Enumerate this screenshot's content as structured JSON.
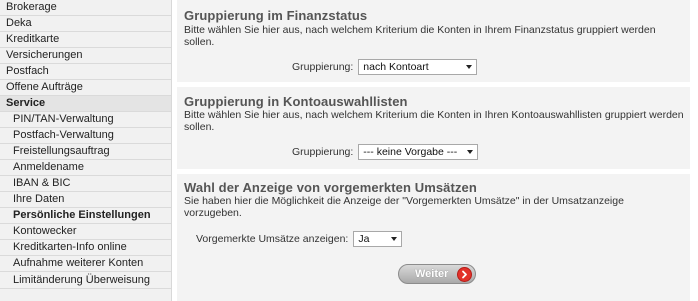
{
  "sidebar": {
    "top_items": [
      "Brokerage",
      "Deka",
      "Kreditkarte",
      "Versicherungen",
      "Postfach",
      "Offene Aufträge"
    ],
    "section": "Service",
    "sub_items": [
      "PIN/TAN-Verwaltung",
      "Postfach-Verwaltung",
      "Freistellungsauftrag",
      "Anmeldename",
      "IBAN & BIC",
      "Ihre Daten",
      "Persönliche Einstellungen",
      "Kontowecker",
      "Kreditkarten-Info online",
      "Aufnahme weiterer Konten",
      "Limitänderung Überweisung"
    ],
    "active_item": "Persönliche Einstellungen"
  },
  "sections": [
    {
      "title": "Gruppierung im Finanzstatus",
      "description": "Bitte wählen Sie hier aus, nach welchem Kriterium die Konten in Ihrem Finanzstatus gruppiert werden sollen.",
      "label": "Gruppierung:",
      "value": "nach Kontoart"
    },
    {
      "title": "Gruppierung in Kontoauswahllisten",
      "description": "Bitte wählen Sie hier aus, nach welchem Kriterium die Konten in Ihren Kontoauswahllisten gruppiert werden sollen.",
      "label": "Gruppierung:",
      "value": "--- keine Vorgabe ---"
    },
    {
      "title": "Wahl der Anzeige von vorgemerkten Umsätzen",
      "description": "Sie haben hier die Möglichkeit die Anzeige der \"Vorgemerkten Umsätze\" in der Umsatzanzeige vorzugeben.",
      "label": "Vorgemerkte Umsätze anzeigen:",
      "value": "Ja"
    }
  ],
  "button": {
    "label": "Weiter",
    "icon": "chevron-right-icon",
    "accent": "#e2312a"
  }
}
